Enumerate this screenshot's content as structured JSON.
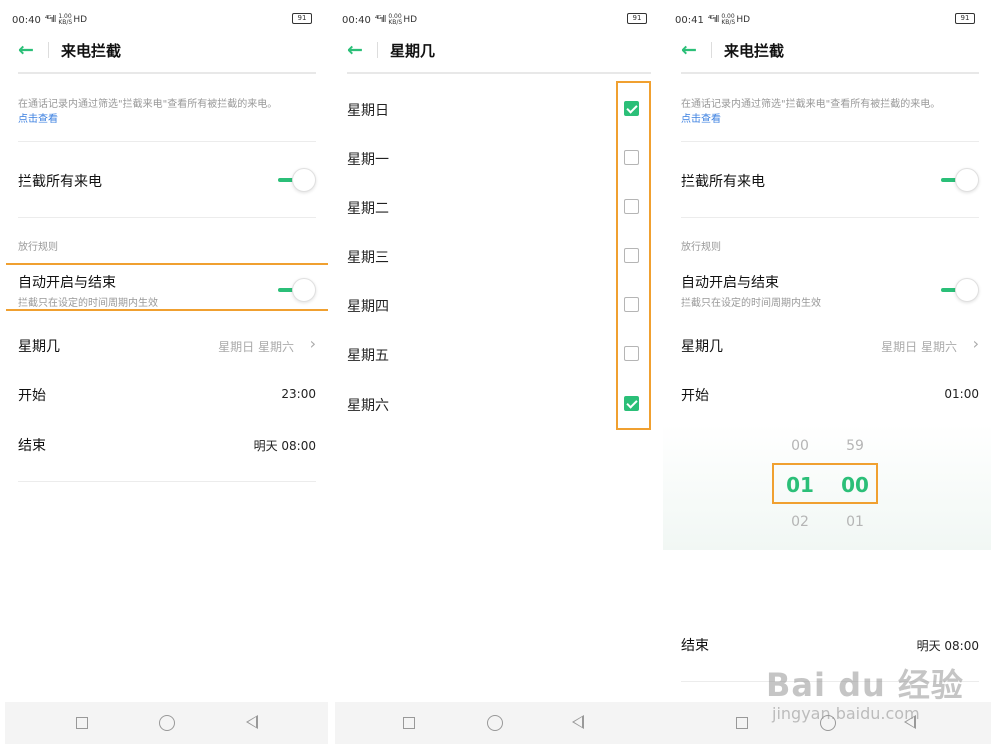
{
  "status_bars": [
    {
      "time": "00:40",
      "signal": "⁴ᴳıll",
      "speed": "1.00 KB/S",
      "hd": "HD",
      "battery": "91"
    },
    {
      "time": "00:40",
      "signal": "⁴ᴳıll",
      "speed": "0.00 KB/S",
      "hd": "HD",
      "battery": "91"
    },
    {
      "time": "00:41",
      "signal": "⁴ᴳıll",
      "speed": "0.00 KB/S",
      "hd": "HD",
      "battery": "91"
    }
  ],
  "panel1": {
    "title": "来电拦截",
    "description": "在通话记录内通过筛选\"拦截来电\"查看所有被拦截的来电。",
    "link": "点击查看",
    "block_all": {
      "label": "拦截所有来电",
      "enabled": true
    },
    "section_label": "放行规则",
    "auto_schedule": {
      "label": "自动开启与结束",
      "sublabel": "拦截只在设定的时间周期内生效",
      "enabled": true
    },
    "days": {
      "label": "星期几",
      "value": "星期日 星期六"
    },
    "start": {
      "label": "开始",
      "value": "23:00"
    },
    "end": {
      "label": "结束",
      "value": "明天 08:00"
    }
  },
  "panel2": {
    "title": "星期几",
    "days": [
      {
        "label": "星期日",
        "checked": true
      },
      {
        "label": "星期一",
        "checked": false
      },
      {
        "label": "星期二",
        "checked": false
      },
      {
        "label": "星期三",
        "checked": false
      },
      {
        "label": "星期四",
        "checked": false
      },
      {
        "label": "星期五",
        "checked": false
      },
      {
        "label": "星期六",
        "checked": true
      }
    ]
  },
  "panel3": {
    "title": "来电拦截",
    "description": "在通话记录内通过筛选\"拦截来电\"查看所有被拦截的来电。",
    "link": "点击查看",
    "block_all": {
      "label": "拦截所有来电",
      "enabled": true
    },
    "section_label": "放行规则",
    "auto_schedule": {
      "label": "自动开启与结束",
      "sublabel": "拦截只在设定的时间周期内生效",
      "enabled": true
    },
    "days": {
      "label": "星期几",
      "value": "星期日 星期六"
    },
    "start": {
      "label": "开始",
      "value": "01:00"
    },
    "picker": {
      "hour_prev": "00",
      "hour": "01",
      "hour_next": "02",
      "minute_prev": "59",
      "minute": "00",
      "minute_next": "01"
    },
    "end": {
      "label": "结束",
      "value": "明天 08:00"
    }
  },
  "watermark": {
    "brand": "Bai du 经验",
    "url": "jingyan.baidu.com"
  },
  "colors": {
    "accent": "#2bbf78",
    "highlight": "#f0a030",
    "link": "#3a7fe0"
  },
  "icons": {
    "back": "back-arrow-icon",
    "chevron": "chevron-right-icon",
    "nav": [
      "square-icon",
      "circle-icon",
      "triangle-back-icon"
    ]
  }
}
